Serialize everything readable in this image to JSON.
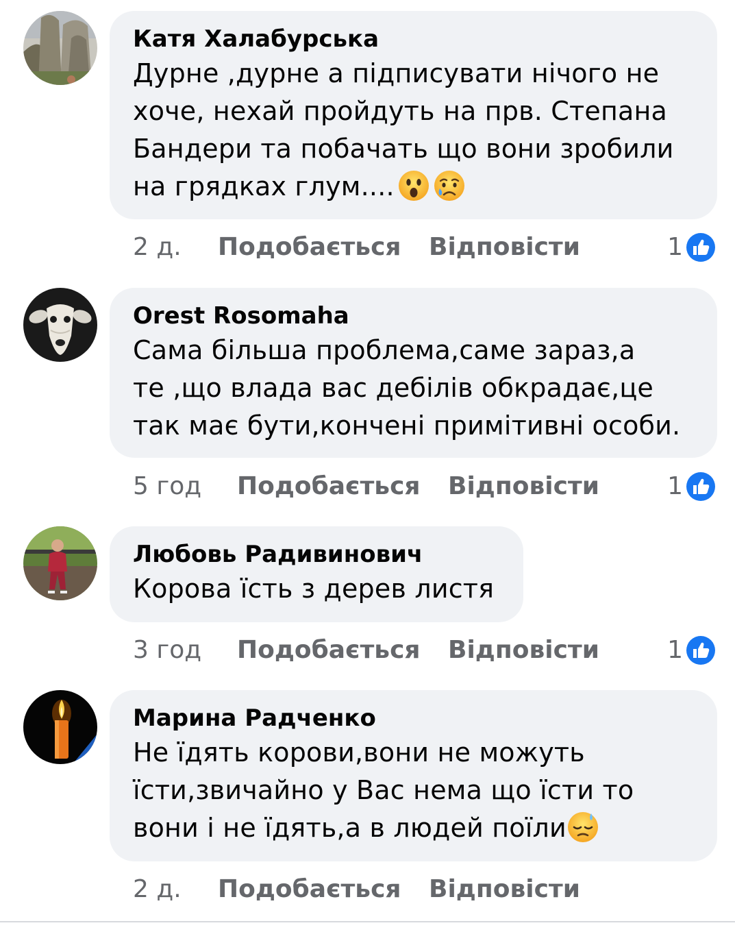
{
  "comments": [
    {
      "author": "Катя Халабурська",
      "lines": [
        "Дурне ,дурне а підписувати нічого не",
        "хоче, нехай пройдуть на прв. Степана",
        "Бандери та побачать що вони зробили",
        "на грядках глум...."
      ],
      "emojis": [
        "astonished-face-emoji",
        "crying-face-emoji"
      ],
      "time": "2 д.",
      "like_label": "Подобається",
      "reply_label": "Відповісти",
      "reaction_count": "1",
      "reaction_icon": "like-reaction-icon",
      "avatar_icon": "rock-landscape-avatar"
    },
    {
      "author": "Orest Rosomaha",
      "lines": [
        "Сама більша проблема,саме зараз,а",
        "те ,що влада вас дебілів обкрадає,це",
        "так має бути,кончені примітивні особи."
      ],
      "time": "5 год",
      "like_label": "Подобається",
      "reply_label": "Відповісти",
      "reaction_count": "1",
      "reaction_icon": "like-reaction-icon",
      "avatar_icon": "dog-avatar"
    },
    {
      "author": "Любовь Радивинович",
      "lines": [
        "Корова їсть з дерев листя"
      ],
      "time": "3 год",
      "like_label": "Подобається",
      "reply_label": "Відповісти",
      "reaction_count": "1",
      "reaction_icon": "like-reaction-icon",
      "avatar_icon": "woman-in-park-avatar"
    },
    {
      "author": "Марина Радченко",
      "lines": [
        "Не їдять корови,вони не можуть",
        "їсти,звичайно у Вас нема що їсти то",
        "вони і не їдять,а в людей поїли"
      ],
      "emojis": [
        "downcast-face-with-sweat-emoji"
      ],
      "time": "2 д.",
      "like_label": "Подобається",
      "reply_label": "Відповісти",
      "avatar_icon": "candle-avatar"
    }
  ],
  "colors": {
    "bubble": "#f0f2f5",
    "secondary_text": "#65676b",
    "like_blue": "#1877f2",
    "ukraine_blue": "#1f5fbf",
    "ukraine_yellow": "#f5d000"
  }
}
